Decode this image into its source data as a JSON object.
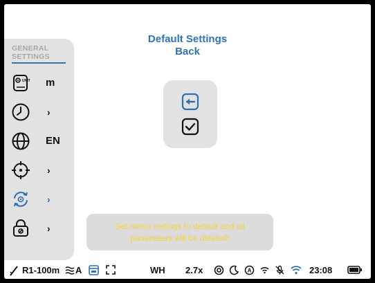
{
  "sidebar": {
    "section_title_line1": "GENERAL",
    "section_title_line2": "SETTINGS",
    "items": [
      {
        "icon": "unit-icon",
        "value": "m"
      },
      {
        "icon": "clock-icon",
        "value": "›"
      },
      {
        "icon": "globe-icon",
        "value": "EN"
      },
      {
        "icon": "crosshair-icon",
        "value": "›"
      },
      {
        "icon": "reset-icon",
        "value": "›",
        "active": true
      },
      {
        "icon": "lock-icon",
        "value": "›"
      }
    ],
    "unit_icon_text": "UNIT"
  },
  "main": {
    "title": "Default Settings",
    "subtitle": "Back",
    "back_icon": "back-arrow-icon",
    "confirm_icon": "checkbox-check-icon",
    "message": "Set menu settings to default and all parameters will be deleted!"
  },
  "statusbar": {
    "profile": "R1-100m",
    "mode": "A",
    "white_hot": "WH",
    "zoom": "2.7x",
    "time": "23:08"
  },
  "colors": {
    "accent_blue": "#2f72b5",
    "panel_gray": "#e2e2e2",
    "warning_yellow": "#f4d53a"
  }
}
